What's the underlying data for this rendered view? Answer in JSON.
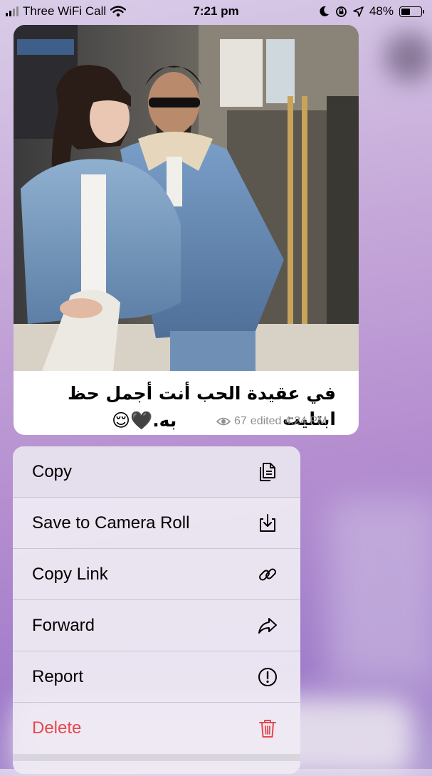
{
  "status_bar": {
    "carrier": "Three WiFi Call",
    "time": "7:21 pm",
    "battery": "48%",
    "battery_level": 0.48
  },
  "message": {
    "caption_line1": "في عقيدة الحب أنت أجمل حظ ابتليت",
    "caption_line2": "به.🖤😌",
    "views": "67",
    "edited_time": "edited 4:24 PM"
  },
  "menu": {
    "items": [
      {
        "label": "Copy",
        "icon": "copy-icon"
      },
      {
        "label": "Save to Camera Roll",
        "icon": "download-icon"
      },
      {
        "label": "Copy Link",
        "icon": "link-icon"
      },
      {
        "label": "Forward",
        "icon": "forward-icon"
      },
      {
        "label": "Report",
        "icon": "exclamation-icon"
      },
      {
        "label": "Delete",
        "icon": "trash-icon"
      }
    ],
    "danger_color": "#e5484d"
  }
}
